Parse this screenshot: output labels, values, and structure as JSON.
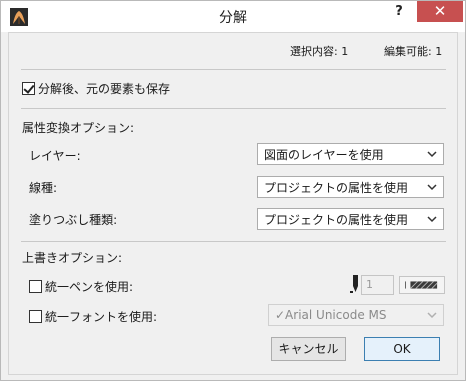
{
  "window": {
    "title": "分解",
    "help_label": "?",
    "close_label": "✕",
    "app_icon": "archicad-app-icon"
  },
  "counts": {
    "selected": "選択内容: 1",
    "editable": "編集可能: 1"
  },
  "keep_original": {
    "label": "分解後、元の要素も保存",
    "checked": true
  },
  "attribute_options": {
    "heading": "属性変換オプション:",
    "layer": {
      "label": "レイヤー:",
      "value": "図面のレイヤーを使用"
    },
    "line_type": {
      "label": "線種:",
      "value": "プロジェクトの属性を使用"
    },
    "fill_type": {
      "label": "塗りつぶし種類:",
      "value": "プロジェクトの属性を使用"
    }
  },
  "override_options": {
    "heading": "上書きオプション:",
    "uniform_pen": {
      "label": "統一ペンを使用:",
      "checked": false,
      "pen_number": "1"
    },
    "uniform_font": {
      "label": "統一フォントを使用:",
      "checked": false,
      "font_value": "✓Arial Unicode MS"
    }
  },
  "buttons": {
    "cancel": "キャンセル",
    "ok": "OK"
  },
  "colors": {
    "close_button": "#c75050",
    "default_button_border": "#3c7fb1"
  }
}
